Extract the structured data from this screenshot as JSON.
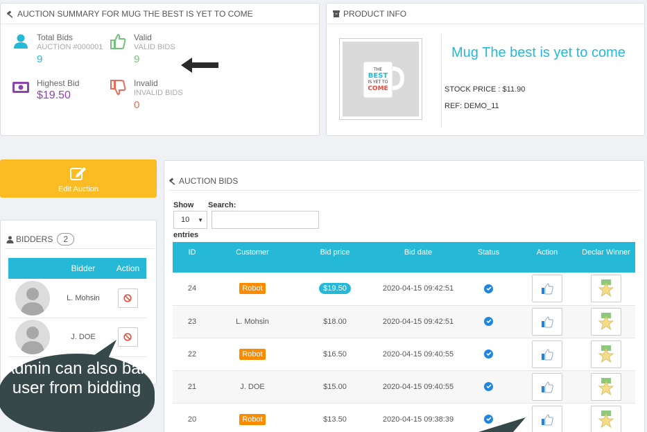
{
  "summary": {
    "title": "AUCTION SUMMARY FOR MUG THE BEST IS YET TO COME",
    "total_bids": {
      "label": "Total Bids",
      "sub": "AUCTION #000001",
      "value": "9"
    },
    "valid": {
      "label": "Valid",
      "sub": "VALID BIDS",
      "value": "9"
    },
    "highest_bid": {
      "label": "Highest Bid",
      "value": "$19.50"
    },
    "invalid": {
      "label": "Invalid",
      "sub": "INVALID BIDS",
      "value": "0"
    }
  },
  "product": {
    "title": "PRODUCT INFO",
    "name": "Mug The best is yet to come",
    "stock_price": "STOCK PRICE : $11.90",
    "ref": "REF: DEMO_11",
    "mug_text": [
      "THE",
      "BEST",
      "IS YET TO",
      "COME"
    ]
  },
  "edit_button": {
    "label": "Edit Auction"
  },
  "bidders": {
    "title": "BIDDERS",
    "count": "2",
    "columns": [
      "Bidder",
      "Action"
    ],
    "rows": [
      {
        "name": "L. Mohsin"
      },
      {
        "name": "J. DOE"
      }
    ]
  },
  "bids": {
    "title": "AUCTION BIDS",
    "show_label": "Show",
    "entries_value": "10",
    "entries_label": "entries",
    "search_label": "Search:",
    "columns": [
      "ID",
      "Customer",
      "Bid price",
      "Bid date",
      "Status",
      "Action",
      "Declar Winner"
    ],
    "rows": [
      {
        "id": "24",
        "customer": "Robot",
        "price": "$19.50",
        "date": "2020-04-15 09:42:51"
      },
      {
        "id": "23",
        "customer": "L. Mohsin",
        "price": "$18.00",
        "date": "2020-04-15 09:42:51"
      },
      {
        "id": "22",
        "customer": "Robot",
        "price": "$16.50",
        "date": "2020-04-15 09:40:55"
      },
      {
        "id": "21",
        "customer": "J. DOE",
        "price": "$15.00",
        "date": "2020-04-15 09:40:55"
      },
      {
        "id": "20",
        "customer": "Robot",
        "price": "$13.50",
        "date": "2020-04-15 09:38:39"
      }
    ]
  },
  "callout": {
    "text": "Admin can also ban user from bidding"
  },
  "colors": {
    "accent": "#25b9d7",
    "orange": "#fb8c00",
    "warning": "#fbbb22",
    "valid": "#72c279",
    "invalid": "#e76d5a",
    "purple": "#8e44ad"
  }
}
